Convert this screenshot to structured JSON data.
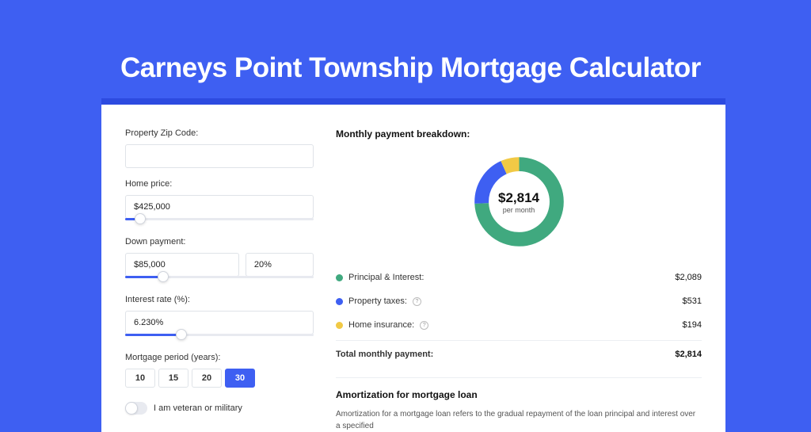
{
  "title": "Carneys Point Township Mortgage Calculator",
  "form": {
    "zip": {
      "label": "Property Zip Code:",
      "value": ""
    },
    "home_price": {
      "label": "Home price:",
      "value": "$425,000",
      "slider_pct": 8
    },
    "down_payment": {
      "label": "Down payment:",
      "value": "$85,000",
      "pct": "20%",
      "slider_pct": 20
    },
    "interest": {
      "label": "Interest rate (%):",
      "value": "6.230%",
      "slider_pct": 30
    },
    "period": {
      "label": "Mortgage period (years):",
      "options": [
        "10",
        "15",
        "20",
        "30"
      ],
      "selected": "30"
    },
    "veteran": {
      "label": "I am veteran or military",
      "on": false
    }
  },
  "breakdown": {
    "heading": "Monthly payment breakdown:",
    "center": {
      "amount": "$2,814",
      "sub": "per month"
    },
    "items": [
      {
        "label": "Principal & Interest:",
        "value": "$2,089",
        "color": "#40a97f",
        "share": 0.742,
        "info": false
      },
      {
        "label": "Property taxes:",
        "value": "$531",
        "color": "#3e5ff2",
        "share": 0.189,
        "info": true
      },
      {
        "label": "Home insurance:",
        "value": "$194",
        "color": "#f1c945",
        "share": 0.069,
        "info": true
      }
    ],
    "total": {
      "label": "Total monthly payment:",
      "value": "$2,814"
    }
  },
  "amort": {
    "heading": "Amortization for mortgage loan",
    "text": "Amortization for a mortgage loan refers to the gradual repayment of the loan principal and interest over a specified"
  },
  "chart_data": {
    "type": "pie",
    "title": "Monthly payment breakdown",
    "total_label": "$2,814 per month",
    "series": [
      {
        "name": "Principal & Interest",
        "value": 2089,
        "color": "#40a97f"
      },
      {
        "name": "Property taxes",
        "value": 531,
        "color": "#3e5ff2"
      },
      {
        "name": "Home insurance",
        "value": 194,
        "color": "#f1c945"
      }
    ]
  }
}
